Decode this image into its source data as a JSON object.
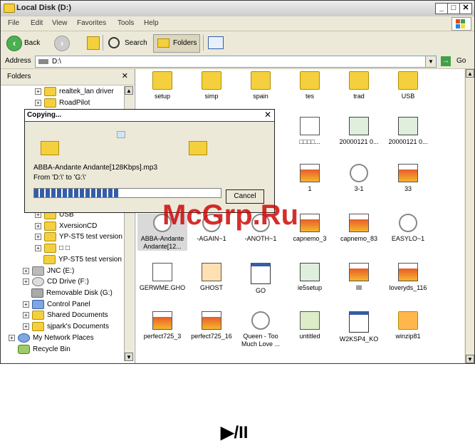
{
  "window": {
    "title": "Local Disk (D:)",
    "controls": [
      "_",
      "□",
      "✕"
    ]
  },
  "menu": [
    "File",
    "Edit",
    "View",
    "Favorites",
    "Tools",
    "Help"
  ],
  "toolbar": {
    "back": "Back",
    "search": "Search",
    "folders": "Folders"
  },
  "address": {
    "label": "Address",
    "value": "D:\\",
    "go": "Go"
  },
  "left_pane": {
    "title": "Folders",
    "items": [
      {
        "label": "realtek_lan driver"
      },
      {
        "label": "RoadPilot"
      },
      {
        "label": "USB"
      },
      {
        "label": "XversionCD"
      },
      {
        "label": "YP-ST5 test version"
      },
      {
        "label": "□ □"
      },
      {
        "label": "YP-ST5 test version"
      },
      {
        "label": "JNC (E:)"
      },
      {
        "label": "CD Drive (F:)"
      },
      {
        "label": "Removable Disk (G:)"
      },
      {
        "label": "Control Panel"
      },
      {
        "label": "Shared Documents"
      },
      {
        "label": "sjpark's Documents"
      },
      {
        "label": "My Network Places"
      },
      {
        "label": "Recycle Bin"
      }
    ]
  },
  "files": [
    {
      "name": "setup"
    },
    {
      "name": "simp"
    },
    {
      "name": "spain"
    },
    {
      "name": "tes"
    },
    {
      "name": "trad"
    },
    {
      "name": "USB"
    },
    {
      "name": "□□□□..."
    },
    {
      "name": "20000121 0..."
    },
    {
      "name": "20000121 0..."
    },
    {
      "name": "..."
    },
    {
      "name": "1"
    },
    {
      "name": "3-1"
    },
    {
      "name": "33"
    },
    {
      "name": "ABBA-Andante Andante[12..."
    },
    {
      "name": "-AGAIN~1"
    },
    {
      "name": "-ANOTH~1"
    },
    {
      "name": "capnemo_3"
    },
    {
      "name": "capnemo_83"
    },
    {
      "name": "EASYLO~1"
    },
    {
      "name": "GERWME.GHO"
    },
    {
      "name": "GHOST"
    },
    {
      "name": "GO"
    },
    {
      "name": "ie5setup"
    },
    {
      "name": "llll"
    },
    {
      "name": "loveryds_116"
    },
    {
      "name": "perfect725_3"
    },
    {
      "name": "perfect725_16"
    },
    {
      "name": "Queen - Too Much Love ..."
    },
    {
      "name": "untitled"
    },
    {
      "name": "W2KSP4_KO"
    },
    {
      "name": "winzip81"
    }
  ],
  "dialog": {
    "title": "Copying...",
    "file": "ABBA-Andante Andante[128Kbps].mp3",
    "route": "From 'D:\\' to 'G:\\'",
    "cancel": "Cancel",
    "progress": 0.45
  },
  "watermark": "McGrp.Ru",
  "caption": "▶/II"
}
